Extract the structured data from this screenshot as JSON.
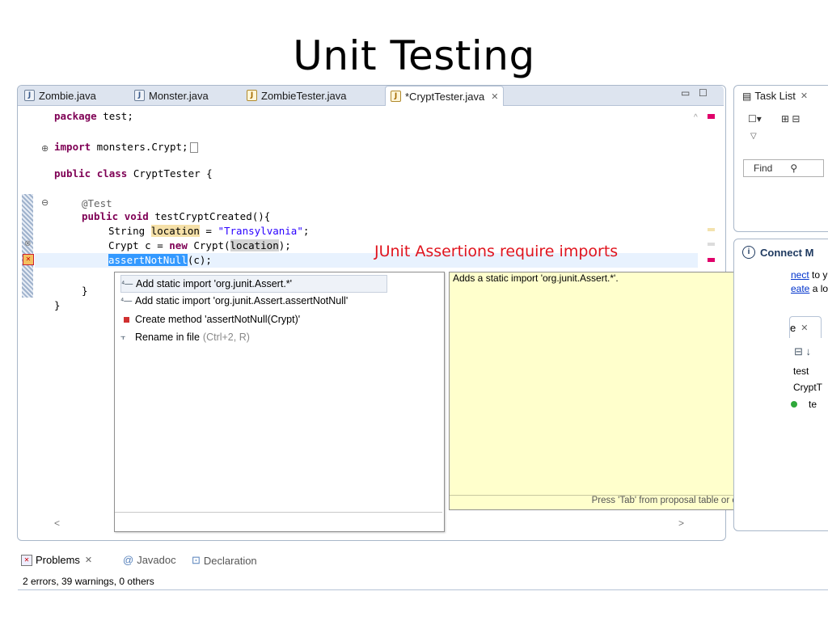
{
  "slide": {
    "title": "Unit Testing"
  },
  "annotation": "JUnit Assertions require imports",
  "editor": {
    "tabs": [
      {
        "label": "Zombie.java"
      },
      {
        "label": "Monster.java"
      },
      {
        "label": "ZombieTester.java"
      },
      {
        "label": "*CryptTester.java",
        "active": true
      }
    ],
    "code": {
      "l1_kw": "package",
      "l1_rest": " test;",
      "l2_kw": "import",
      "l2_rest": " monsters.Crypt;",
      "l3_kw1": "public",
      "l3_kw2": "class",
      "l3_rest": " CryptTester {",
      "l4_ann": "@Test",
      "l5_kw1": "public",
      "l5_kw2": "void",
      "l5_rest": " testCryptCreated(){",
      "l6_a": "String ",
      "l6_var": "location",
      "l6_b": " = ",
      "l6_str": "\"Transylvania\"",
      "l6_c": ";",
      "l7_a": "Crypt c = ",
      "l7_kw": "new",
      "l7_b": " Crypt(",
      "l7_var": "location",
      "l7_c": ");",
      "l8_sel": "assertNotNull",
      "l8_rest": "(c);",
      "l9": "}",
      "l10": "}"
    }
  },
  "proposals": [
    {
      "label": "Add static import 'org.junit.Assert.*'",
      "icon": "static-import-icon"
    },
    {
      "label": "Add static import 'org.junit.Assert.assertNotNull'",
      "icon": "static-import-icon"
    },
    {
      "label": "Create method 'assertNotNull(Crypt)'",
      "icon": "method-icon"
    },
    {
      "label": "Rename in file",
      "shortcut": "(Ctrl+2, R)",
      "icon": "rename-icon"
    }
  ],
  "info_popup": {
    "text": "Adds a static import 'org.junit.Assert.*'.",
    "status": "Press 'Tab' from proposal table or click for focus"
  },
  "task_list": {
    "title": "Task List",
    "find": "Find"
  },
  "connect": {
    "title": "Connect M",
    "line1_link": "nect",
    "line1_rest": " to y",
    "line2_link": "eate",
    "line2_rest": " a lo"
  },
  "outline": {
    "title": "e",
    "items": [
      "test",
      "CryptT",
      "te"
    ]
  },
  "bottom": {
    "tabs": [
      {
        "label": "Problems",
        "active": true
      },
      {
        "label": "Javadoc"
      },
      {
        "label": "Declaration"
      }
    ],
    "status": "2 errors, 39 warnings, 0 others"
  },
  "colors": {
    "keyword": "#7f0055",
    "string": "#2a00ff",
    "annotation_red": "#e0141e",
    "info_bg": "#ffffcc"
  }
}
